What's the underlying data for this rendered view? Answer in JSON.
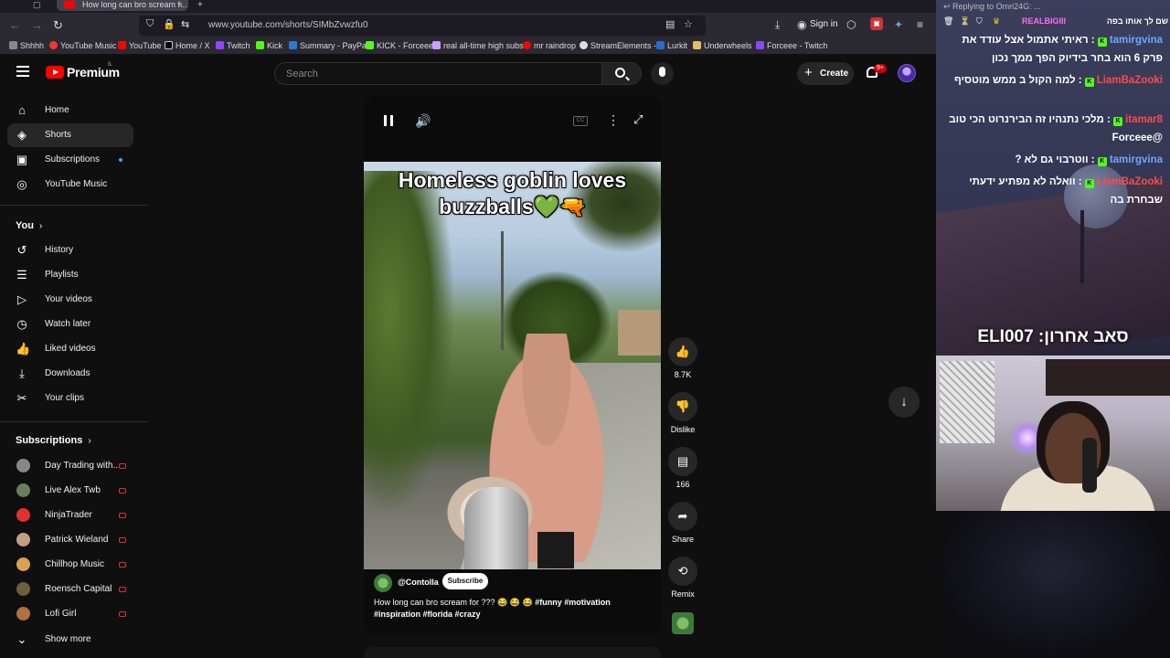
{
  "browser": {
    "tab_title": "How long can bro scream f...",
    "url": "www.youtube.com/shorts/SIMbZvwzfu0",
    "signin_label": "Sign in",
    "bookmarks": [
      "Shhhh",
      "YouTube Music",
      "YouTube",
      "Home / X",
      "Twitch",
      "Kick",
      "Summary - PayPal",
      "KICK - Forceee",
      "real all-time high subs",
      "mr raindrop",
      "StreamElements -",
      "Lurkit",
      "Underwheels",
      "Forceee - Twitch"
    ]
  },
  "header": {
    "brand": "Premium",
    "brand_sup": "IL",
    "search_placeholder": "Search",
    "create_label": "Create",
    "notification_count": "9+"
  },
  "sidebar": {
    "main": [
      {
        "label": "Home",
        "icon": "home-icon"
      },
      {
        "label": "Shorts",
        "icon": "shorts-icon",
        "active": true
      },
      {
        "label": "Subscriptions",
        "icon": "subscriptions-icon"
      },
      {
        "label": "YouTube Music",
        "icon": "music-icon"
      }
    ],
    "you_heading": "You",
    "you": [
      {
        "label": "History",
        "icon": "history-icon"
      },
      {
        "label": "Playlists",
        "icon": "playlists-icon"
      },
      {
        "label": "Your videos",
        "icon": "your-videos-icon"
      },
      {
        "label": "Watch later",
        "icon": "clock-icon"
      },
      {
        "label": "Liked videos",
        "icon": "thumbs-up-icon"
      },
      {
        "label": "Downloads",
        "icon": "download-icon"
      },
      {
        "label": "Your clips",
        "icon": "scissors-icon"
      }
    ],
    "subs_heading": "Subscriptions",
    "subs": [
      {
        "label": "Day Trading with...",
        "color": "#888888"
      },
      {
        "label": "Live Alex Twb",
        "color": "#6b7f5a"
      },
      {
        "label": "NinjaTrader",
        "color": "#e03030"
      },
      {
        "label": "Patrick Wieland",
        "color": "#c0a080"
      },
      {
        "label": "Chillhop Music",
        "color": "#d8a050"
      },
      {
        "label": "Roensch Capital",
        "color": "#6b6040"
      },
      {
        "label": "Lofi Girl",
        "color": "#b07040"
      }
    ],
    "show_more": "Show more"
  },
  "short": {
    "caption_line1": "Homeless goblin loves",
    "caption_line2": "buzzballs",
    "caption_emoji": "💚🔫",
    "channel": "@Contolla",
    "subscribe_label": "Subscribe",
    "description_plain": "How  long can bro scream for ??? 😂 😂 😂",
    "description_tags1": "#funny #motivation",
    "description_tags2": "#inspiration #florida #crazy",
    "actions": {
      "likes": "8.7K",
      "dislike": "Dislike",
      "comments": "166",
      "share": "Share",
      "remix": "Remix"
    }
  },
  "overlay": {
    "reply_text": "Replying to Omri24G: ...",
    "top_user": "REALBIGIII",
    "top_msg": "שם לך אותו בפה",
    "chat": [
      {
        "user": "tamirgvina",
        "msg": "ראיתי אתמול אצל עודד את פרק 6 הוא בחר בידיוק הפך ממך נכון",
        "color": "#6aa8ff"
      },
      {
        "user": "LiamBaZooki",
        "msg": "למה הקול ב ממש מוטסיף",
        "color": "#ff4a4a"
      },
      {
        "user": "itamar8",
        "msg": "מלכי נתנהיו זה הבירנרוט הכי טוב @Forceee",
        "color": "#ff4a4a"
      },
      {
        "user": "tamirgvina",
        "msg": "ווטרבוי גם לא ?",
        "color": "#6aa8ff"
      },
      {
        "user": "LiamBaZooki",
        "msg": "וואלה לא מפתיע ידעתי שבחרת בה",
        "color": "#ff4a4a"
      }
    ],
    "sub_alert": "סאב אחרון: ELI007"
  }
}
